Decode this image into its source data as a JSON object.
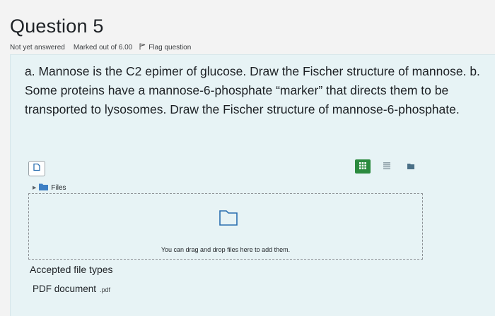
{
  "question": {
    "title": "Question 5",
    "status": "Not yet answered",
    "marks": "Marked out of 6.00",
    "flag_label": "Flag question",
    "text": "a. Mannose is the C2 epimer of glucose. Draw the Fischer structure of mannose. b. Some proteins have a mannose-6-phosphate “marker” that directs them to be transported to lysosomes. Draw the Fischer structure of mannose-6-phosphate."
  },
  "filepicker": {
    "folder_label": "Files",
    "dropzone_text": "You can drag and drop files here to add them.",
    "view_icons": [
      "icons-view-icon",
      "list-view-icon",
      "tree-view-icon"
    ]
  },
  "accepted": {
    "heading": "Accepted file types",
    "type_name": "PDF document",
    "type_ext": ".pdf"
  },
  "colors": {
    "card_bg": "#e7f3f5",
    "active_view": "#2b8a3e",
    "folder": "#3d7fc4"
  }
}
